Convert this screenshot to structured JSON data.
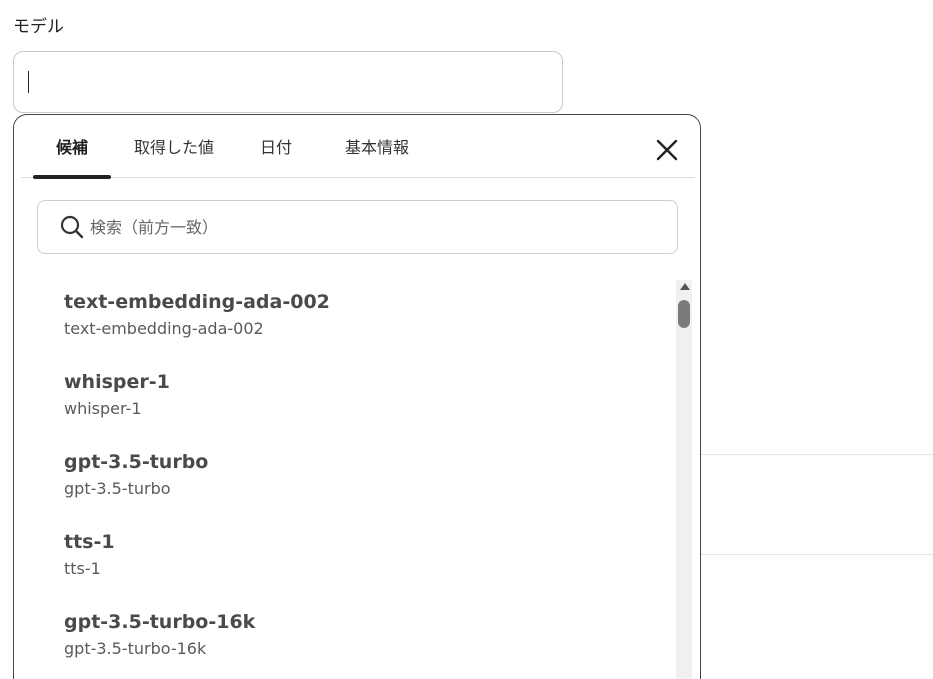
{
  "field": {
    "label": "モデル",
    "value": ""
  },
  "popup": {
    "tabs": [
      {
        "label": "候補",
        "active": true
      },
      {
        "label": "取得した値",
        "active": false
      },
      {
        "label": "日付",
        "active": false
      },
      {
        "label": "基本情報",
        "active": false
      }
    ],
    "close_icon": "close-icon",
    "search": {
      "placeholder": "検索（前方一致）",
      "icon": "search-icon"
    },
    "items": [
      {
        "title": "text-embedding-ada-002",
        "subtitle": "text-embedding-ada-002"
      },
      {
        "title": "whisper-1",
        "subtitle": "whisper-1"
      },
      {
        "title": "gpt-3.5-turbo",
        "subtitle": "gpt-3.5-turbo"
      },
      {
        "title": "tts-1",
        "subtitle": "tts-1"
      },
      {
        "title": "gpt-3.5-turbo-16k",
        "subtitle": "gpt-3.5-turbo-16k"
      }
    ]
  },
  "colors": {
    "active_tab_indicator": "#222222",
    "popup_border": "#444444",
    "item_title": "#4a4a4a"
  }
}
